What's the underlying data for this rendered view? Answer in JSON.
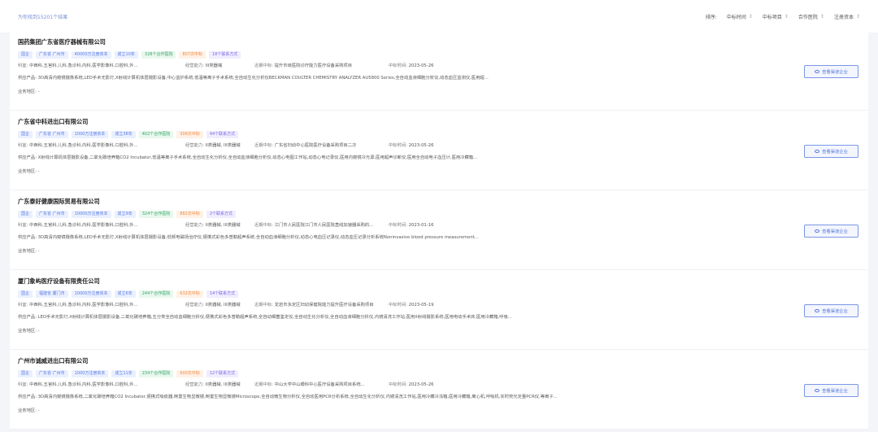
{
  "header": {
    "result_count": "为你找到15201个结果",
    "sorts": [
      {
        "label": "排序:",
        "caret": ""
      },
      {
        "label": "中标时间",
        "caret": "↕"
      },
      {
        "label": "中标项目",
        "caret": "↕"
      },
      {
        "label": "合作医院",
        "caret": "↕"
      },
      {
        "label": "注册资本",
        "caret": "↕"
      }
    ]
  },
  "colors": {
    "accent": "#5677d8",
    "tag_blue": "#5b7be0",
    "tag_green": "#3aa46b",
    "tag_orange": "#f08a3c",
    "tag_purple": "#7c6be0"
  },
  "labels": {
    "keshi": "科室:",
    "jingying": "经营能力:",
    "zhongbiao": "近期中标:",
    "zhongbiao_time": "中标时间:",
    "gongying": "供应产品:",
    "yewu": "业务地区:",
    "detail_button": "查看渠道企业"
  },
  "companies": [
    {
      "name": "国药集团广东省医疗器械有限公司",
      "tags": [
        "国企",
        "广东省 广州市",
        "40000万注册资本",
        "成立10年",
        "328个合作医院",
        "807次中标",
        "18个联系方式"
      ],
      "keshi": "中西科,五官科,儿科,急诊科,内科,医学影像科,口腔科,外...",
      "jingying": "III类器械",
      "zhongbiao": "提升市级医院诊疗能力医疗设备采购项目",
      "zhongbiao_time": "2023-05-26",
      "gongying": "3D高清内窥镜摄像系统,LED手术无影灯,X射线计算机体层摄影设备,中心监护系统,低温等离子手术系统,全自动生化分析仪BECKMAN COULTER CHEMISTRY ANALYZER AU5800 Series,全自动血液细胞分析仪,动态血压监测仪,医用超...",
      "yewu": "-"
    },
    {
      "name": "广东省中科进出口有限公司",
      "tags": [
        "国企",
        "广东省 广州市",
        "1000万注册资本",
        "成立38年",
        "402个合作医院",
        "306次中标",
        "44个联系方式"
      ],
      "keshi": "中西科,五官科,儿科,急诊科,内科,医学影像科,口腔科,外...",
      "jingying": "II类器械, III类器械",
      "zhongbiao": "广东省妇幼中心医院医疗设备采购项目二次",
      "zhongbiao_time": "2023-05-26",
      "gongying": "X射线计算机体层摄影设备,二氧化碳培养箱CO2 Incubator,低温等离子手术系统,全自动生化分析仪,全自动血液细胞分析仪,动态心电图工作站,动态心电记录仪,医用内窥镜冷光源,医用超声诊断仪,医用全自动电子血压计,医用冷藏箱...",
      "yewu": "-"
    },
    {
      "name": "广东泰好健康国际贸易有限公司",
      "tags": [
        "国企",
        "广东省 广州市",
        "10000万注册资本",
        "成立9年",
        "324个合作医院",
        "882次中标",
        "2个联系方式"
      ],
      "keshi": "中西科,五官科,儿科,急诊科,内科,医学影像科,口腔科,外...",
      "jingying": "II类器械, III类器械",
      "zhongbiao": "江门市人民医院江门市人民医院直线加速器采购的...",
      "zhongbiao_time": "2023-01-16",
      "gongying": "3D高清内窥镜摄像系统,LED手术无影灯,X射线计算机体层摄影设备,低频电磁场治疗仪,便携式彩色多普勒超声系统,全自动血液细胞分析仪,动态心电血压记录仪,动态血压记录分析系统Noninvasive blood pressure measurement...",
      "yewu": "-"
    },
    {
      "name": "厦门象屿医疗设备有限责任公司",
      "tags": [
        "国企",
        "福建省 厦门市",
        "10000万注册资本",
        "成立6年",
        "244个合作医院",
        "632次中标",
        "14个联系方式"
      ],
      "keshi": "中西科,五官科,儿科,急诊科,内科,医学影像科,口腔科,外...",
      "jingying": "II类器械, III类器械",
      "zhongbiao": "龙岩市永定区妇幼保健院能力提升医疗设备采购项目",
      "zhongbiao_time": "2023-05-19",
      "gongying": "LED手术无影灯,X射线计算机体层摄影设备,二氧化碳培养箱,五分类全自动血细胞分析仪,便携式彩色多普勒超声系统,全自动细菌鉴定仪,全自动生化分析仪,全自动血液细胞分析仪,内镜清洗工作站,医用X射线摄影系统,医用电动手术床,医用冷藏箱,呼吸...",
      "yewu": "-"
    },
    {
      "name": "广州市诚威进出口有限公司",
      "tags": [
        "国企",
        "广东省 广州市",
        "1000万注册资本",
        "成立11年",
        "234个合作医院",
        "600次中标",
        "12个联系方式"
      ],
      "keshi": "中西科,五官科,儿科,急诊科,内科,医学影像科,口腔科,外...",
      "jingying": "II类器械, III类器械",
      "zhongbiao": "中山大学中山眼科中心医疗设备采购项目系统...",
      "zhongbiao_time": "2023-05-26",
      "gongying": "3D高清内窥镜摄像系统,二氧化碳培养箱CO2 Incubator,便携式吸痰器,倒置生物显微镜,倒置生物显微镜Microscope,全自动微生物分析仪,全自动医用PCR分析系统,全自动生化分析仪,内镜清洗工作站,医用冷藏冷冻箱,医用冷藏箱,离心机,呼吸机,实时荧光定量PCR仪,等离子...",
      "yewu": "-"
    }
  ]
}
